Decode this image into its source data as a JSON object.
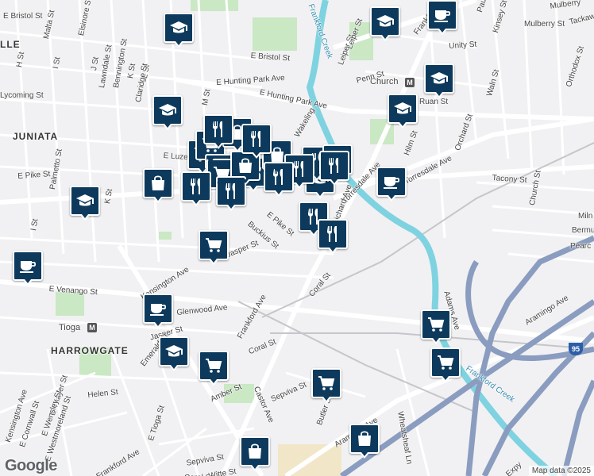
{
  "attribution": "Map data ©2025",
  "logo": "Google",
  "highway_shield": "95",
  "colors": {
    "pin": "#0d3a5c",
    "river": "#7fd3e0",
    "park": "#c9e8c3",
    "highway": "#8a9cbf"
  },
  "neighborhoods": [
    {
      "text": "JUNIATA"
    },
    {
      "text": "HARROWGATE"
    },
    {
      "text": "LLE"
    }
  ],
  "transit": [
    {
      "text": "Church"
    },
    {
      "text": "Tioga"
    }
  ],
  "waterway_labels": [
    {
      "text": "Frankford Creek"
    },
    {
      "text": "Frankford Creek"
    }
  ],
  "street_labels": [
    {
      "text": "E Bristol St"
    },
    {
      "text": "Malta St"
    },
    {
      "text": "Elsinore St"
    },
    {
      "text": "E Hunting Park Ave"
    },
    {
      "text": "H St"
    },
    {
      "text": "I St"
    },
    {
      "text": "J St"
    },
    {
      "text": "Lawndale St"
    },
    {
      "text": "Bennington St"
    },
    {
      "text": "K St"
    },
    {
      "text": "L St"
    },
    {
      "text": "Claridge St"
    },
    {
      "text": "E Hunting Park Ave"
    },
    {
      "text": "E Bristol St"
    },
    {
      "text": "Leiper St"
    },
    {
      "text": "Penn St"
    },
    {
      "text": "Frankford Ave"
    },
    {
      "text": "Unity St"
    },
    {
      "text": "Paul St"
    },
    {
      "text": "Kinsey St"
    },
    {
      "text": "Mulberry"
    },
    {
      "text": "Tackaw"
    },
    {
      "text": "Orthodox St"
    },
    {
      "text": "Ruan St"
    },
    {
      "text": "Waln St"
    },
    {
      "text": "Orchard St"
    },
    {
      "text": "Torresdale Ave"
    },
    {
      "text": "Tacony St"
    },
    {
      "text": "Church St"
    },
    {
      "text": "Miln"
    },
    {
      "text": "Bermu"
    },
    {
      "text": "Pearc"
    },
    {
      "text": "E Luzerne St"
    },
    {
      "text": "E Pike St"
    },
    {
      "text": "Palmetto St"
    },
    {
      "text": "I St"
    },
    {
      "text": "K St"
    },
    {
      "text": "E Pike St"
    },
    {
      "text": "Buckius St"
    },
    {
      "text": "Jasper St"
    },
    {
      "text": "Kensington Ave"
    },
    {
      "text": "E Venango St"
    },
    {
      "text": "Glenwood Ave"
    },
    {
      "text": "Coral St"
    },
    {
      "text": "Frankford Ave"
    },
    {
      "text": "Coral St"
    },
    {
      "text": "Jasper St"
    },
    {
      "text": "Emerald St"
    },
    {
      "text": "Helen St"
    },
    {
      "text": "Kensington Ave"
    },
    {
      "text": "E Thayer St"
    },
    {
      "text": "E Wensley St"
    },
    {
      "text": "E Cornwall St"
    },
    {
      "text": "E Westmoreland St"
    },
    {
      "text": "Amber St"
    },
    {
      "text": "Castor Ave"
    },
    {
      "text": "Sepviva St"
    },
    {
      "text": "Butler St"
    },
    {
      "text": "Aramingo Ave"
    },
    {
      "text": "Wheatsheaf Ln"
    },
    {
      "text": "E Tioga St"
    },
    {
      "text": "Frankford Ave"
    },
    {
      "text": "Sepviva St"
    },
    {
      "text": "Witte St"
    },
    {
      "text": "Coral St"
    },
    {
      "text": "Adams Ave"
    },
    {
      "text": "Aramingo Ave"
    },
    {
      "text": "Expy"
    },
    {
      "text": "Torresdale Ave"
    },
    {
      "text": "Richard Ave"
    },
    {
      "text": "Wakeling"
    },
    {
      "text": "Lycoming St"
    },
    {
      "text": "Mulberry St"
    },
    {
      "text": "M St"
    },
    {
      "text": "Leiper St"
    },
    {
      "text": "Hilm St"
    }
  ],
  "places": [
    {
      "type": "school"
    },
    {
      "type": "school"
    },
    {
      "type": "school"
    },
    {
      "type": "school"
    },
    {
      "type": "school"
    },
    {
      "type": "school"
    },
    {
      "type": "school"
    },
    {
      "type": "school"
    },
    {
      "type": "cafe"
    },
    {
      "type": "cafe"
    },
    {
      "type": "cafe"
    },
    {
      "type": "cafe"
    },
    {
      "type": "grocery"
    },
    {
      "type": "grocery"
    },
    {
      "type": "grocery"
    },
    {
      "type": "grocery"
    },
    {
      "type": "grocery"
    },
    {
      "type": "grocery"
    },
    {
      "type": "grocery"
    },
    {
      "type": "grocery"
    },
    {
      "type": "grocery"
    },
    {
      "type": "grocery"
    },
    {
      "type": "grocery"
    },
    {
      "type": "shopping"
    },
    {
      "type": "shopping"
    },
    {
      "type": "shopping"
    },
    {
      "type": "shopping"
    },
    {
      "type": "shopping"
    },
    {
      "type": "shopping"
    },
    {
      "type": "restaurant"
    },
    {
      "type": "restaurant"
    },
    {
      "type": "restaurant"
    },
    {
      "type": "restaurant"
    },
    {
      "type": "restaurant"
    },
    {
      "type": "restaurant"
    },
    {
      "type": "restaurant"
    },
    {
      "type": "restaurant"
    },
    {
      "type": "restaurant"
    },
    {
      "type": "restaurant"
    },
    {
      "type": "restaurant"
    }
  ]
}
